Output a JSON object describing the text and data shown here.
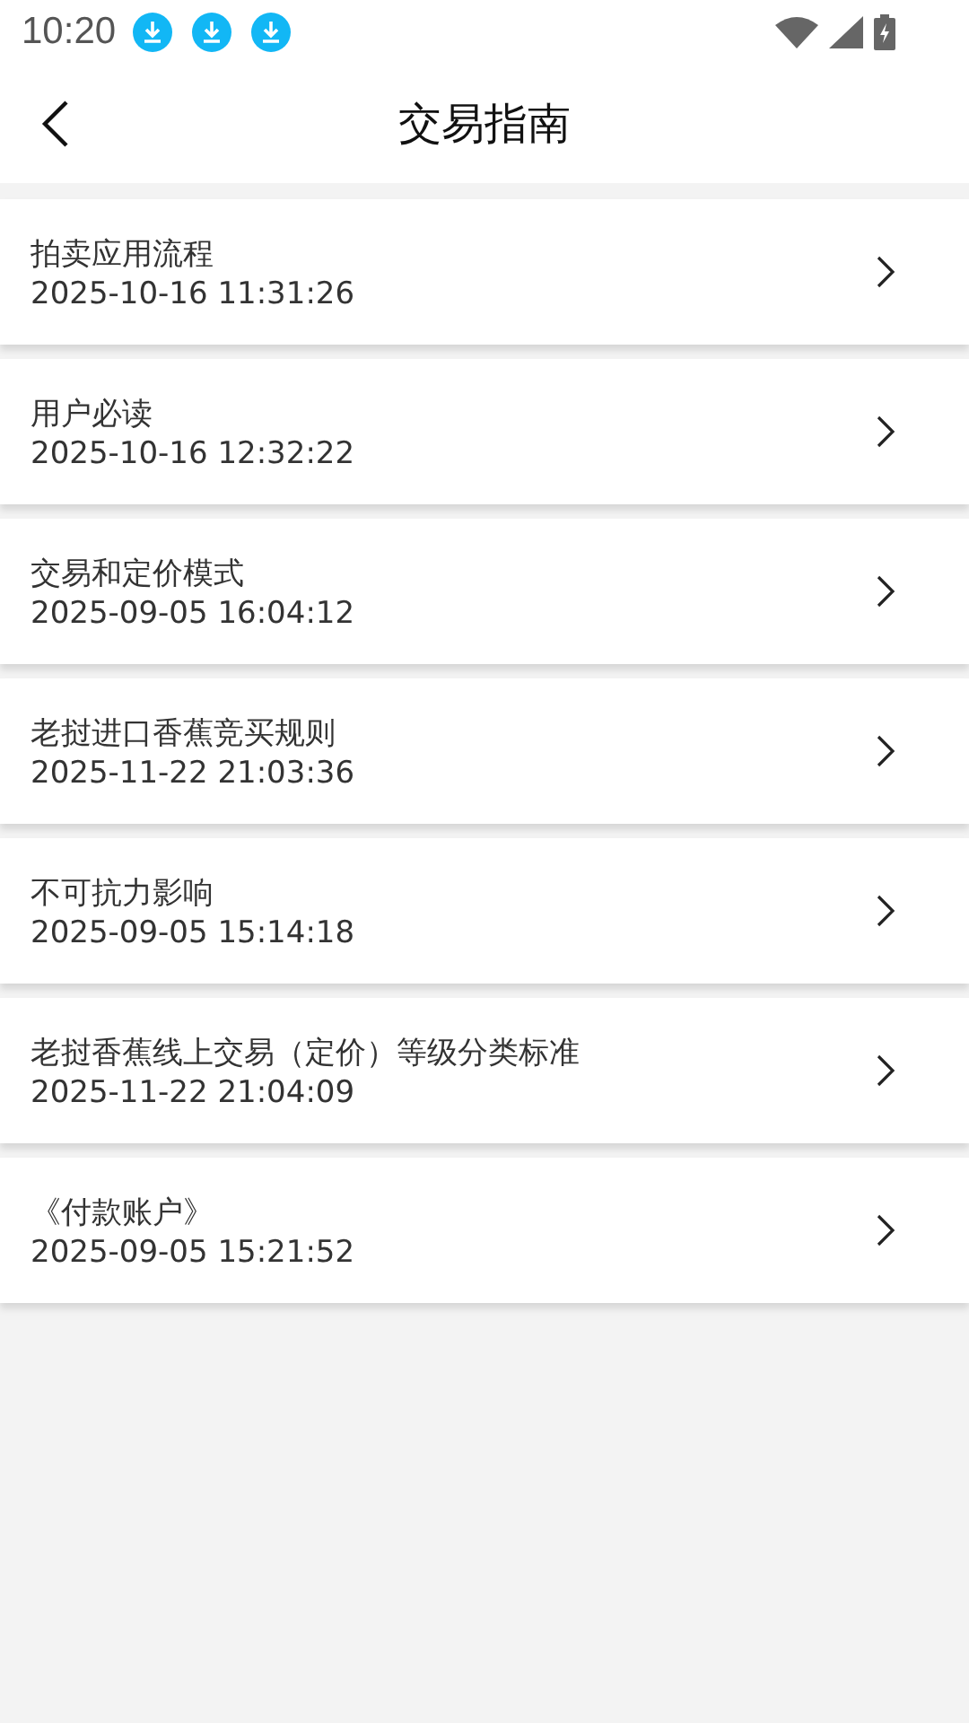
{
  "status_bar": {
    "time": "10:20",
    "notifications": [
      {
        "kind": "download"
      },
      {
        "kind": "download"
      },
      {
        "kind": "download"
      }
    ]
  },
  "header": {
    "title": "交易指南"
  },
  "items": [
    {
      "title": "拍卖应用流程",
      "date": "2025-10-16 11:31:26"
    },
    {
      "title": "用户必读",
      "date": "2025-10-16 12:32:22"
    },
    {
      "title": "交易和定价模式",
      "date": "2025-09-05 16:04:12"
    },
    {
      "title": "老挝进口香蕉竞买规则",
      "date": "2025-11-22 21:03:36"
    },
    {
      "title": "不可抗力影响",
      "date": "2025-09-05 15:14:18"
    },
    {
      "title": "老挝香蕉线上交易（定价）等级分类标准",
      "date": "2025-11-22 21:04:09"
    },
    {
      "title": "《付款账户》",
      "date": "2025-09-05 15:21:52"
    }
  ]
}
